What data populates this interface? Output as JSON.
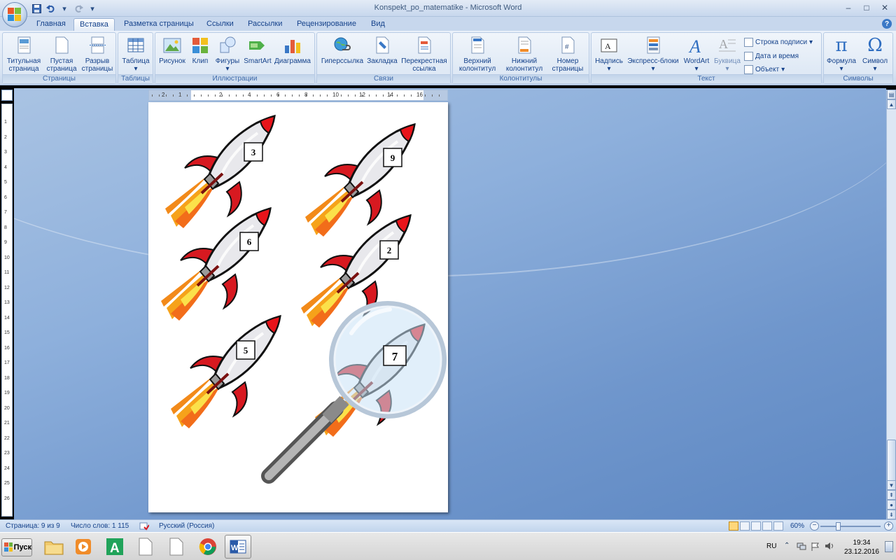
{
  "window": {
    "title": "Konspekt_po_matematike - Microsoft Word",
    "controls": {
      "minimize": "–",
      "maximize": "□",
      "close": "✕"
    }
  },
  "qat": {
    "save_icon": "save-icon",
    "undo_icon": "undo-icon",
    "redo_icon": "redo-icon",
    "customize": "▾"
  },
  "tabs": [
    {
      "label": "Главная",
      "active": false
    },
    {
      "label": "Вставка",
      "active": true
    },
    {
      "label": "Разметка страницы",
      "active": false
    },
    {
      "label": "Ссылки",
      "active": false
    },
    {
      "label": "Рассылки",
      "active": false
    },
    {
      "label": "Рецензирование",
      "active": false
    },
    {
      "label": "Вид",
      "active": false
    }
  ],
  "ribbon": {
    "pages": {
      "label": "Страницы",
      "cover_1": "Титульная",
      "cover_2": "страница",
      "blank_1": "Пустая",
      "blank_2": "страница",
      "break_1": "Разрыв",
      "break_2": "страницы"
    },
    "tables": {
      "label": "Таблицы",
      "table": "Таблица"
    },
    "illustrations": {
      "label": "Иллюстрации",
      "picture": "Рисунок",
      "clip": "Клип",
      "shapes": "Фигуры",
      "smartart": "SmartArt",
      "chart": "Диаграмма"
    },
    "links": {
      "label": "Связи",
      "hyperlink": "Гиперссылка",
      "bookmark": "Закладка",
      "crossref_1": "Перекрестная",
      "crossref_2": "ссылка"
    },
    "headers": {
      "label": "Колонтитулы",
      "header_1": "Верхний",
      "header_2": "колонтитул",
      "footer_1": "Нижний",
      "footer_2": "колонтитул",
      "pagenum_1": "Номер",
      "pagenum_2": "страницы"
    },
    "text": {
      "label": "Текст",
      "textbox": "Надпись",
      "quickparts": "Экспресс-блоки",
      "wordart": "WordArt",
      "dropcap": "Буквица",
      "signature": "Строка подписи",
      "datetime": "Дата и время",
      "object": "Объект"
    },
    "symbols": {
      "label": "Символы",
      "equation": "Формула",
      "symbol": "Символ"
    }
  },
  "ruler": {
    "numbers": [
      "2",
      "1",
      "2",
      "4",
      "6",
      "8",
      "10",
      "12",
      "14",
      "16"
    ],
    "vnumbers": [
      "1",
      "2",
      "3",
      "4",
      "5",
      "6",
      "7",
      "8",
      "9",
      "10",
      "11",
      "12",
      "13",
      "14",
      "15",
      "16",
      "17",
      "18",
      "19",
      "20",
      "21",
      "22",
      "23",
      "24",
      "25",
      "26"
    ]
  },
  "rockets": [
    {
      "number": "3"
    },
    {
      "number": "9"
    },
    {
      "number": "6"
    },
    {
      "number": "2"
    },
    {
      "number": "5"
    },
    {
      "number": "7"
    }
  ],
  "status": {
    "page": "Страница: 9 из 9",
    "words": "Число слов: 1 115",
    "language": "Русский (Россия)",
    "zoom": "60%",
    "zoom_level": 60
  },
  "taskbar": {
    "start": "Пуск",
    "apps": [
      "folder-icon",
      "media-player-icon",
      "green-a-icon",
      "document-icon",
      "document-icon",
      "chrome-icon",
      "word-icon"
    ],
    "lang": "RU",
    "time": "19:34",
    "date": "23.12.2016"
  },
  "colors": {
    "ribbon_blue": "#dbe6f4",
    "doc_bg": "#6f96cc",
    "rocket_red": "#e8141a"
  }
}
